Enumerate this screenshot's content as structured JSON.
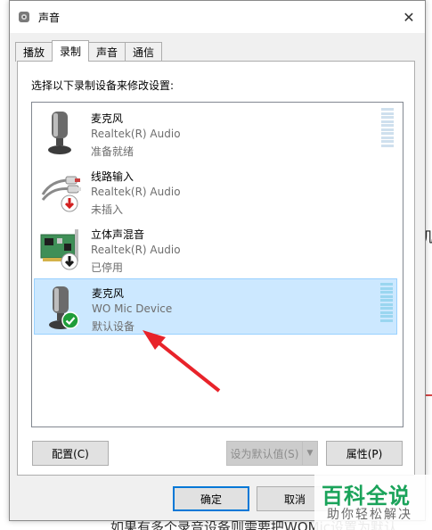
{
  "window": {
    "title": "声音"
  },
  "tabs": [
    {
      "label": "播放"
    },
    {
      "label": "录制",
      "active": true
    },
    {
      "label": "声音"
    },
    {
      "label": "通信"
    }
  ],
  "instruction": "选择以下录制设备来修改设置:",
  "devices": [
    {
      "name": "麦克风",
      "driver": "Realtek(R) Audio",
      "status": "准备就绪",
      "icon": "microphone-icon"
    },
    {
      "name": "线路输入",
      "driver": "Realtek(R) Audio",
      "status": "未插入",
      "icon": "line-in-cable-icon",
      "badge": "red-down-arrow"
    },
    {
      "name": "立体声混音",
      "driver": "Realtek(R) Audio",
      "status": "已停用",
      "icon": "sound-card-icon",
      "badge": "black-down-arrow"
    },
    {
      "name": "麦克风",
      "driver": "WO Mic Device",
      "status": "默认设备",
      "icon": "microphone-icon",
      "badge": "green-check",
      "selected": true
    }
  ],
  "buttons": {
    "configure": "配置(C)",
    "set_default": "设为默认值(S)",
    "properties": "属性(P)",
    "ok": "确定",
    "cancel": "取消"
  },
  "background": {
    "right_char": "机",
    "bottom_text": "如果有多个录音设备则需要把WOMic设置为默认"
  },
  "watermark": {
    "title": "百科全说",
    "subtitle": "助你轻松解决"
  },
  "colors": {
    "selection": "#cce8ff",
    "accent": "#0078d7",
    "annotation_arrow": "#e8232a",
    "watermark_green": "#1aa35a"
  }
}
